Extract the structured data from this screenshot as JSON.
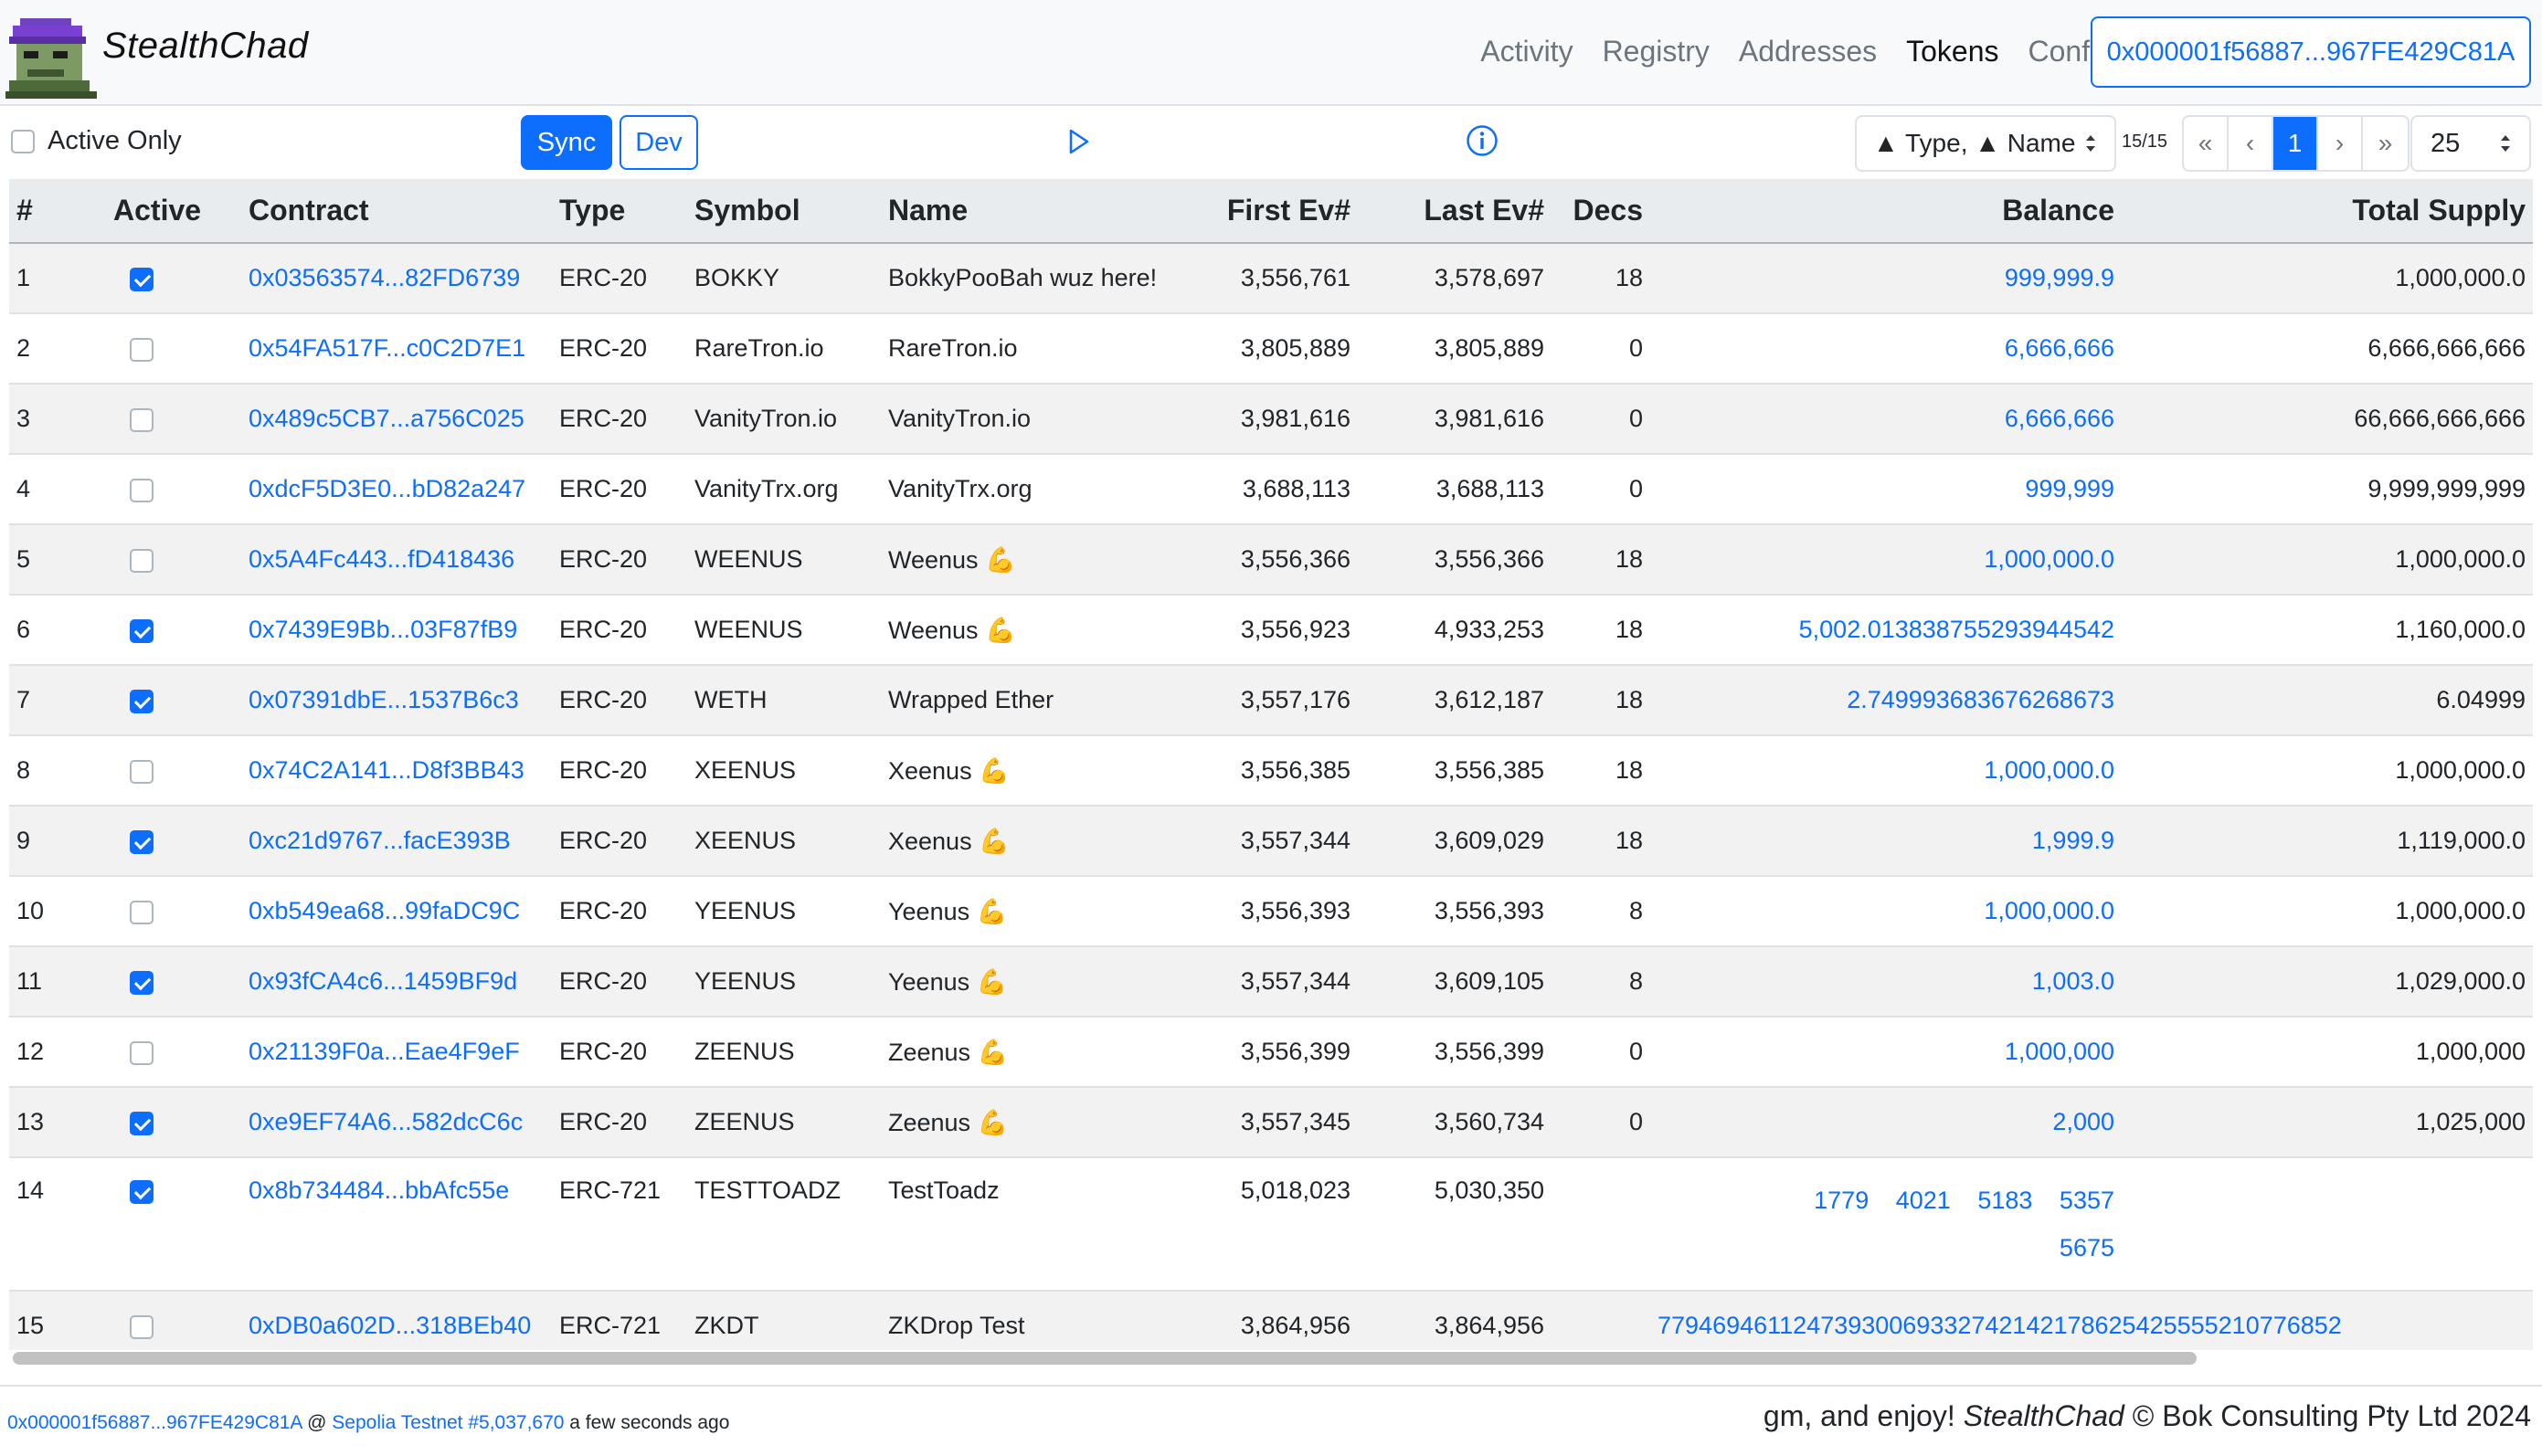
{
  "app": {
    "brand": "StealthChad",
    "nav": [
      "Activity",
      "Registry",
      "Addresses",
      "Tokens",
      "Config"
    ],
    "active_nav": "Tokens",
    "account": "0x000001f56887...967FE429C81A"
  },
  "toolbar": {
    "active_only_label": "Active Only",
    "sync_label": "Sync",
    "dev_label": "Dev",
    "sort_label": "▲ Type, ▲ Name",
    "page_count": "15/15",
    "pager": [
      "«",
      "‹",
      "1",
      "›",
      "»"
    ],
    "page_size": "25"
  },
  "table": {
    "headers": [
      "#",
      "Active",
      "Contract",
      "Type",
      "Symbol",
      "Name",
      "First Ev#",
      "Last Ev#",
      "Decs",
      "Balance",
      "Total Supply"
    ],
    "rows": [
      {
        "n": "1",
        "active": true,
        "contract": "0x03563574...82FD6739",
        "type": "ERC-20",
        "symbol": "BOKKY",
        "name": "BokkyPooBah wuz here!",
        "first": "3,556,761",
        "last": "3,578,697",
        "decs": "18",
        "balance": "999,999.9",
        "supply": "1,000,000.0"
      },
      {
        "n": "2",
        "active": false,
        "contract": "0x54FA517F...c0C2D7E1",
        "type": "ERC-20",
        "symbol": "RareTron.io",
        "name": "RareTron.io",
        "first": "3,805,889",
        "last": "3,805,889",
        "decs": "0",
        "balance": "6,666,666",
        "supply": "6,666,666,666"
      },
      {
        "n": "3",
        "active": false,
        "contract": "0x489c5CB7...a756C025",
        "type": "ERC-20",
        "symbol": "VanityTron.io",
        "name": "VanityTron.io",
        "first": "3,981,616",
        "last": "3,981,616",
        "decs": "0",
        "balance": "6,666,666",
        "supply": "66,666,666,666"
      },
      {
        "n": "4",
        "active": false,
        "contract": "0xdcF5D3E0...bD82a247",
        "type": "ERC-20",
        "symbol": "VanityTrx.org",
        "name": "VanityTrx.org",
        "first": "3,688,113",
        "last": "3,688,113",
        "decs": "0",
        "balance": "999,999",
        "supply": "9,999,999,999"
      },
      {
        "n": "5",
        "active": false,
        "contract": "0x5A4Fc443...fD418436",
        "type": "ERC-20",
        "symbol": "WEENUS",
        "name": "Weenus 💪",
        "first": "3,556,366",
        "last": "3,556,366",
        "decs": "18",
        "balance": "1,000,000.0",
        "supply": "1,000,000.0"
      },
      {
        "n": "6",
        "active": true,
        "contract": "0x7439E9Bb...03F87fB9",
        "type": "ERC-20",
        "symbol": "WEENUS",
        "name": "Weenus 💪",
        "first": "3,556,923",
        "last": "4,933,253",
        "decs": "18",
        "balance": "5,002.013838755293944542",
        "supply": "1,160,000.0"
      },
      {
        "n": "7",
        "active": true,
        "contract": "0x07391dbE...1537B6c3",
        "type": "ERC-20",
        "symbol": "WETH",
        "name": "Wrapped Ether",
        "first": "3,557,176",
        "last": "3,612,187",
        "decs": "18",
        "balance": "2.749993683676268673",
        "supply": "6.04999"
      },
      {
        "n": "8",
        "active": false,
        "contract": "0x74C2A141...D8f3BB43",
        "type": "ERC-20",
        "symbol": "XEENUS",
        "name": "Xeenus 💪",
        "first": "3,556,385",
        "last": "3,556,385",
        "decs": "18",
        "balance": "1,000,000.0",
        "supply": "1,000,000.0"
      },
      {
        "n": "9",
        "active": true,
        "contract": "0xc21d9767...facE393B",
        "type": "ERC-20",
        "symbol": "XEENUS",
        "name": "Xeenus 💪",
        "first": "3,557,344",
        "last": "3,609,029",
        "decs": "18",
        "balance": "1,999.9",
        "supply": "1,119,000.0"
      },
      {
        "n": "10",
        "active": false,
        "contract": "0xb549ea68...99faDC9C",
        "type": "ERC-20",
        "symbol": "YEENUS",
        "name": "Yeenus 💪",
        "first": "3,556,393",
        "last": "3,556,393",
        "decs": "8",
        "balance": "1,000,000.0",
        "supply": "1,000,000.0"
      },
      {
        "n": "11",
        "active": true,
        "contract": "0x93fCA4c6...1459BF9d",
        "type": "ERC-20",
        "symbol": "YEENUS",
        "name": "Yeenus 💪",
        "first": "3,557,344",
        "last": "3,609,105",
        "decs": "8",
        "balance": "1,003.0",
        "supply": "1,029,000.0"
      },
      {
        "n": "12",
        "active": false,
        "contract": "0x21139F0a...Eae4F9eF",
        "type": "ERC-20",
        "symbol": "ZEENUS",
        "name": "Zeenus 💪",
        "first": "3,556,399",
        "last": "3,556,399",
        "decs": "0",
        "balance": "1,000,000",
        "supply": "1,000,000"
      },
      {
        "n": "13",
        "active": true,
        "contract": "0xe9EF74A6...582dcC6c",
        "type": "ERC-20",
        "symbol": "ZEENUS",
        "name": "Zeenus 💪",
        "first": "3,557,345",
        "last": "3,560,734",
        "decs": "0",
        "balance": "2,000",
        "supply": "1,025,000"
      },
      {
        "n": "14",
        "active": true,
        "contract": "0x8b734484...bbAfc55e",
        "type": "ERC-721",
        "symbol": "TESTTOADZ",
        "name": "TestToadz",
        "first": "5,018,023",
        "last": "5,030,350",
        "decs": "",
        "balance_ids": [
          "1779",
          "4021",
          "5183",
          "5357",
          "5675"
        ],
        "supply": ""
      },
      {
        "n": "15",
        "active": false,
        "contract": "0xDB0a602D...318BEb40",
        "type": "ERC-721",
        "symbol": "ZKDT",
        "name": "ZKDrop Test",
        "first": "3,864,956",
        "last": "3,864,956",
        "decs": "",
        "balance": "77946946112473930069332742142178625425555210776852",
        "supply": ""
      }
    ]
  },
  "footer": {
    "account": "0x000001f56887...967FE429C81A",
    "at": "@",
    "network": "Sepolia Testnet #5,037,670",
    "time": "a few seconds ago",
    "right_prefix": "gm, and enjoy!",
    "right_brand": "StealthChad",
    "right_suffix": "© Bok Consulting Pty Ltd 2024"
  },
  "colors": {
    "primary": "#0d6efd",
    "navbar_bg": "#f8f9fa",
    "stripe": "#f2f2f2"
  },
  "icons": {
    "play": "play-icon",
    "info": "info-icon",
    "logo": "logo-icon"
  }
}
